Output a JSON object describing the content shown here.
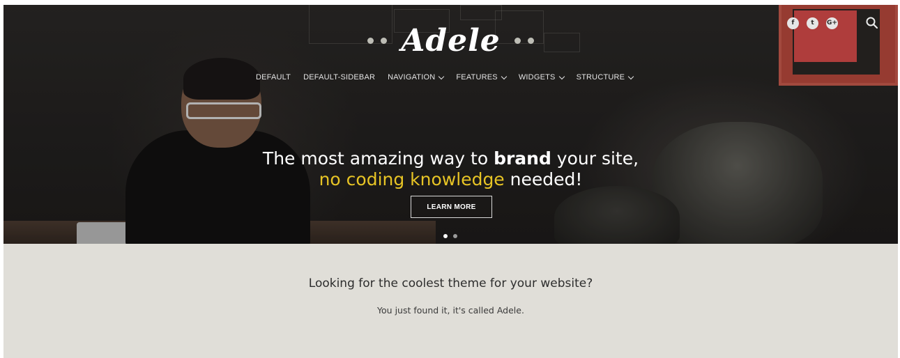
{
  "header": {
    "logo": "Adele",
    "social": [
      {
        "icon": "facebook-icon",
        "glyph": "f"
      },
      {
        "icon": "twitter-icon",
        "glyph": "t"
      },
      {
        "icon": "google-plus-icon",
        "glyph": "G+"
      }
    ],
    "search_icon": "search-icon"
  },
  "nav": {
    "items": [
      {
        "label": "DEFAULT",
        "has_submenu": false
      },
      {
        "label": "DEFAULT-SIDEBAR",
        "has_submenu": false
      },
      {
        "label": "NAVIGATION",
        "has_submenu": true
      },
      {
        "label": "FEATURES",
        "has_submenu": true
      },
      {
        "label": "WIDGETS",
        "has_submenu": true
      },
      {
        "label": "STRUCTURE",
        "has_submenu": true
      }
    ]
  },
  "hero": {
    "line1_pre": "The most amazing way to ",
    "line1_bold": "brand",
    "line1_post": " your site,",
    "line2_highlight": "no coding knowledge",
    "line2_post": " needed!",
    "button_label": "LEARN MORE",
    "slides_total": 2,
    "active_slide": 1
  },
  "intro": {
    "title": "Looking for the coolest theme for your website?",
    "subtitle": "You just found it, it's called Adele."
  },
  "colors": {
    "highlight": "#e7c425",
    "intro_bg": "#e0ded8",
    "poster": "#c65a4c"
  }
}
